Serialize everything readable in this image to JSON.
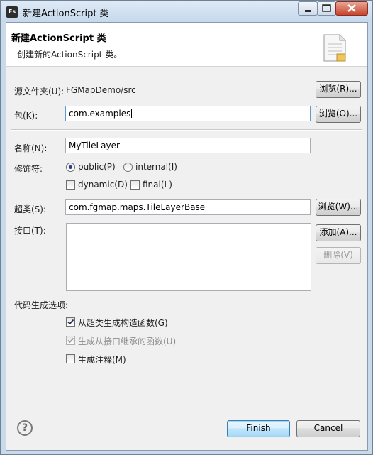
{
  "window": {
    "title": "新建ActionScript 类",
    "app_icon_text": "Fs"
  },
  "header": {
    "title": "新建ActionScript 类",
    "description": "创建新的ActionScript 类。"
  },
  "source_folder": {
    "label": "源文件夹(U):",
    "value": "FGMapDemo/src",
    "browse_label": "浏览(R)..."
  },
  "package": {
    "label": "包(K):",
    "value": "com.examples",
    "browse_label": "浏览(O)..."
  },
  "name": {
    "label": "名称(N):",
    "value": "MyTileLayer"
  },
  "modifiers": {
    "label": "修饰符:",
    "public_label": "public(P)",
    "public_checked": true,
    "internal_label": "internal(I)",
    "internal_checked": false,
    "dynamic_label": "dynamic(D)",
    "dynamic_checked": false,
    "final_label": "final(L)",
    "final_checked": false
  },
  "superclass": {
    "label": "超类(S):",
    "value": "com.fgmap.maps.TileLayerBase",
    "browse_label": "浏览(W)..."
  },
  "interfaces": {
    "label": "接口(T):",
    "add_label": "添加(A)...",
    "remove_label": "删除(V)",
    "items": []
  },
  "codegen": {
    "label": "代码生成选项:",
    "option1_label": "从超类生成构造函数(G)",
    "option1_checked": true,
    "option2_label": "生成从接口继承的函数(U)",
    "option2_checked": true,
    "option2_enabled": false,
    "option3_label": "生成注释(M)",
    "option3_checked": false
  },
  "footer": {
    "help_symbol": "?",
    "finish_label": "Finish",
    "cancel_label": "Cancel"
  },
  "icons": {
    "app": "flash-builder-icon",
    "minimize": "minimize-icon",
    "maximize": "maximize-icon",
    "close": "close-icon",
    "header": "new-class-document-icon",
    "help": "help-icon",
    "check": "checkmark-icon"
  },
  "colors": {
    "title_bar": "#c6d8ec",
    "close_button": "#c7452d",
    "dialog_background": "#f0f0f0",
    "default_button": "#bee6fd",
    "focus_border": "#5b9bd5"
  }
}
